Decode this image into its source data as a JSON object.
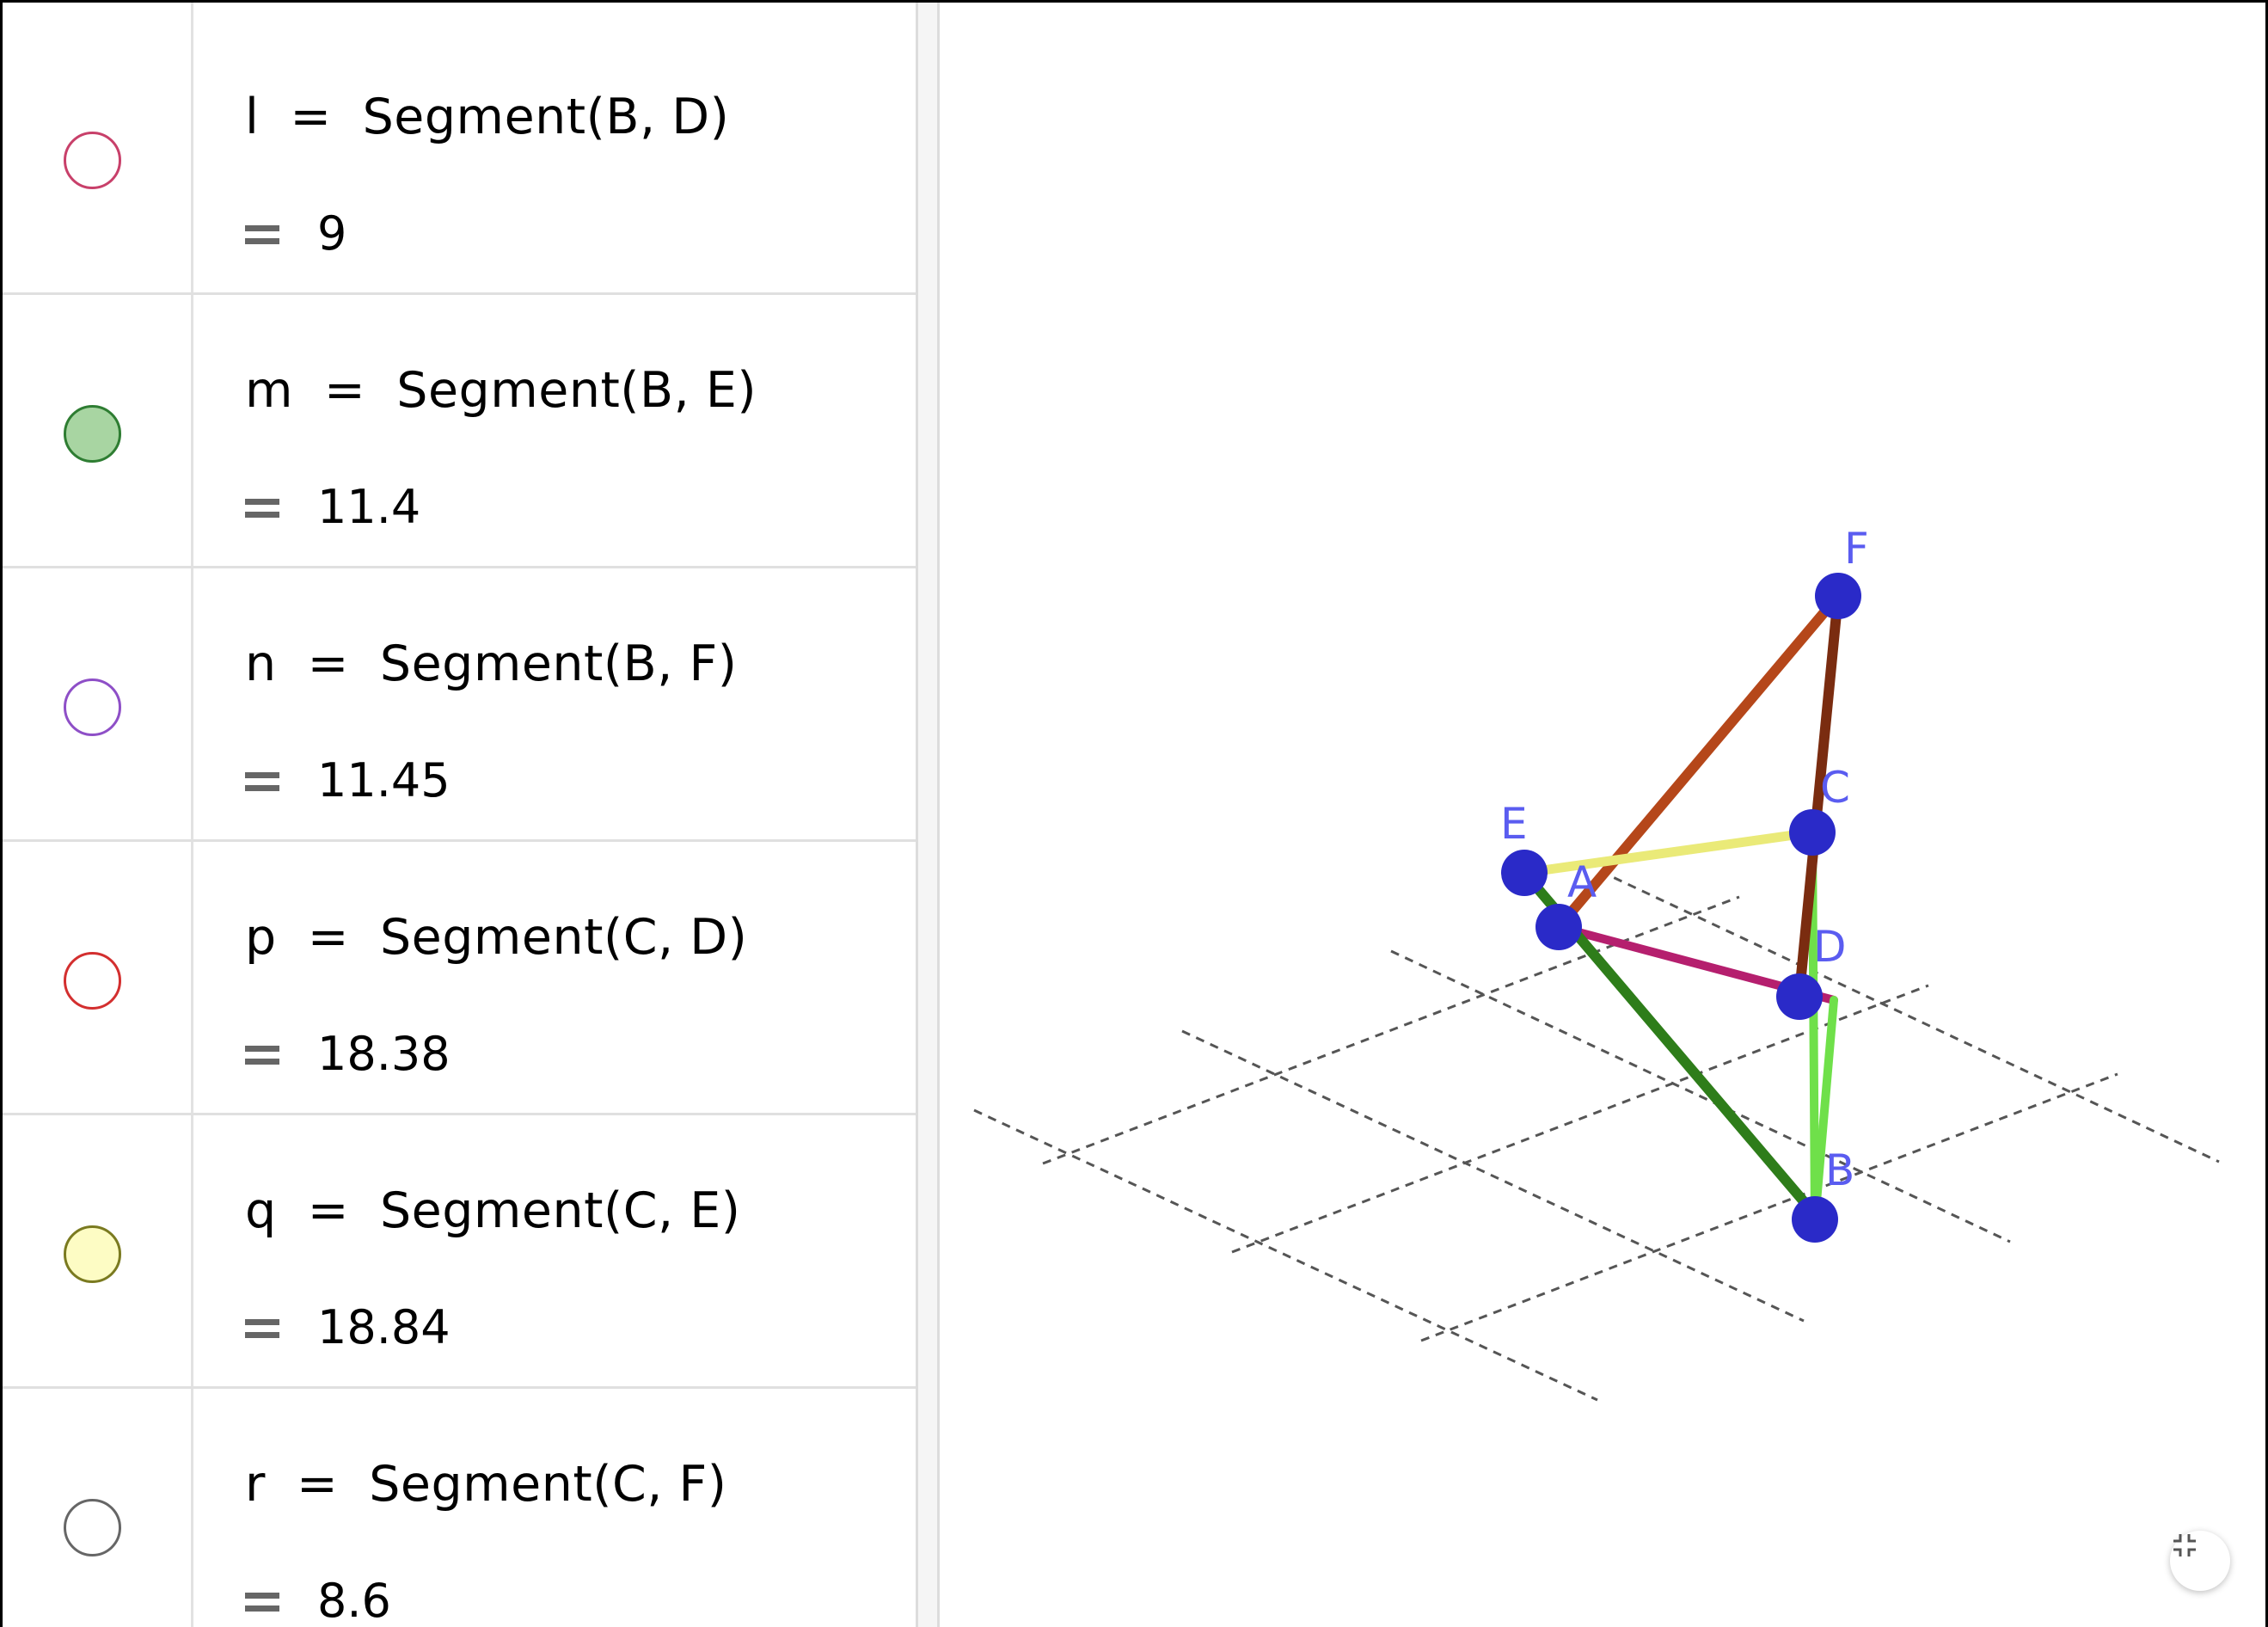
{
  "algebra_view": {
    "items": [
      {
        "name": "l",
        "definition": "Segment(B, D)",
        "value": "9",
        "color": "#c8406a",
        "filled": false
      },
      {
        "name": "m",
        "definition": "Segment(B, E)",
        "value": "11.4",
        "color": "#2e7d32",
        "fill": "#a8d5a2",
        "filled": true
      },
      {
        "name": "n",
        "definition": "Segment(B, F)",
        "value": "11.45",
        "color": "#8e4fc7",
        "filled": false
      },
      {
        "name": "p",
        "definition": "Segment(C, D)",
        "value": "18.38",
        "color": "#d32f2f",
        "filled": false
      },
      {
        "name": "q",
        "definition": "Segment(C, E)",
        "value": "18.84",
        "color": "#7a7a20",
        "fill": "#fdfcc4",
        "filled": true
      },
      {
        "name": "r",
        "definition": "Segment(C, F)",
        "value": "8.6",
        "color": "#666666",
        "filled": false
      }
    ]
  },
  "graphics_view": {
    "points": [
      "F",
      "C",
      "E",
      "A",
      "D",
      "B"
    ],
    "point_color": "#2a2ac8",
    "label_color": "#5a5cf0",
    "segment_colors": {
      "AF": "#b5471a",
      "CF": "#7a2c10",
      "EC": "#eaea78",
      "AD": "#b51f6e",
      "EB": "#2e7d1a",
      "CB": "#6fe04a"
    },
    "fullscreen_icon": "exit-fullscreen-icon"
  }
}
